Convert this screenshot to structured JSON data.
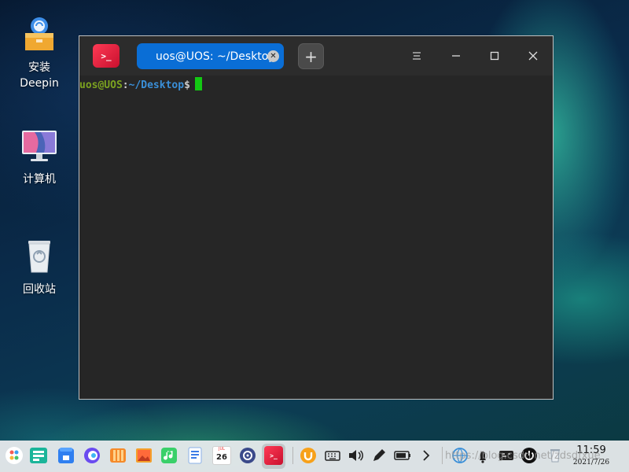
{
  "desktop": {
    "icons": [
      {
        "label_line1": "安装",
        "label_line2": "Deepin",
        "icon": "installer-box-icon"
      },
      {
        "label": "计算机",
        "icon": "computer-monitor-icon"
      },
      {
        "label": "回收站",
        "icon": "trash-bin-icon"
      }
    ]
  },
  "terminal": {
    "app_icon": "terminal-icon",
    "tab_title": "uos@UOS: ~/Desktop",
    "new_tab_label": "+",
    "prompt_user": "uos@UOS",
    "prompt_colon": ":",
    "prompt_path": "~/Desktop",
    "prompt_symbol": "$",
    "colors": {
      "tab_active": "#0a6ed6",
      "user": "#7ca320",
      "path": "#3a8fd8",
      "cursor": "#13c813",
      "background": "#262626"
    }
  },
  "dock": {
    "items": [
      "launcher-icon",
      "multitasking-icon",
      "app-store-icon",
      "browser-icon",
      "file-manager-icon",
      "photos-icon",
      "music-icon",
      "document-viewer-icon",
      "calendar-icon",
      "settings-icon",
      "terminal-icon",
      "uos-id-icon",
      "keyboard-icon",
      "volume-icon",
      "pen-icon",
      "battery-icon",
      "expand-arrow-icon"
    ],
    "calendar_day": "26",
    "calendar_month": "JUL",
    "clock_time": "11:59",
    "clock_date": "2021/7/26",
    "watermark": "https://blog.csdn.net/zdsdfxue"
  }
}
